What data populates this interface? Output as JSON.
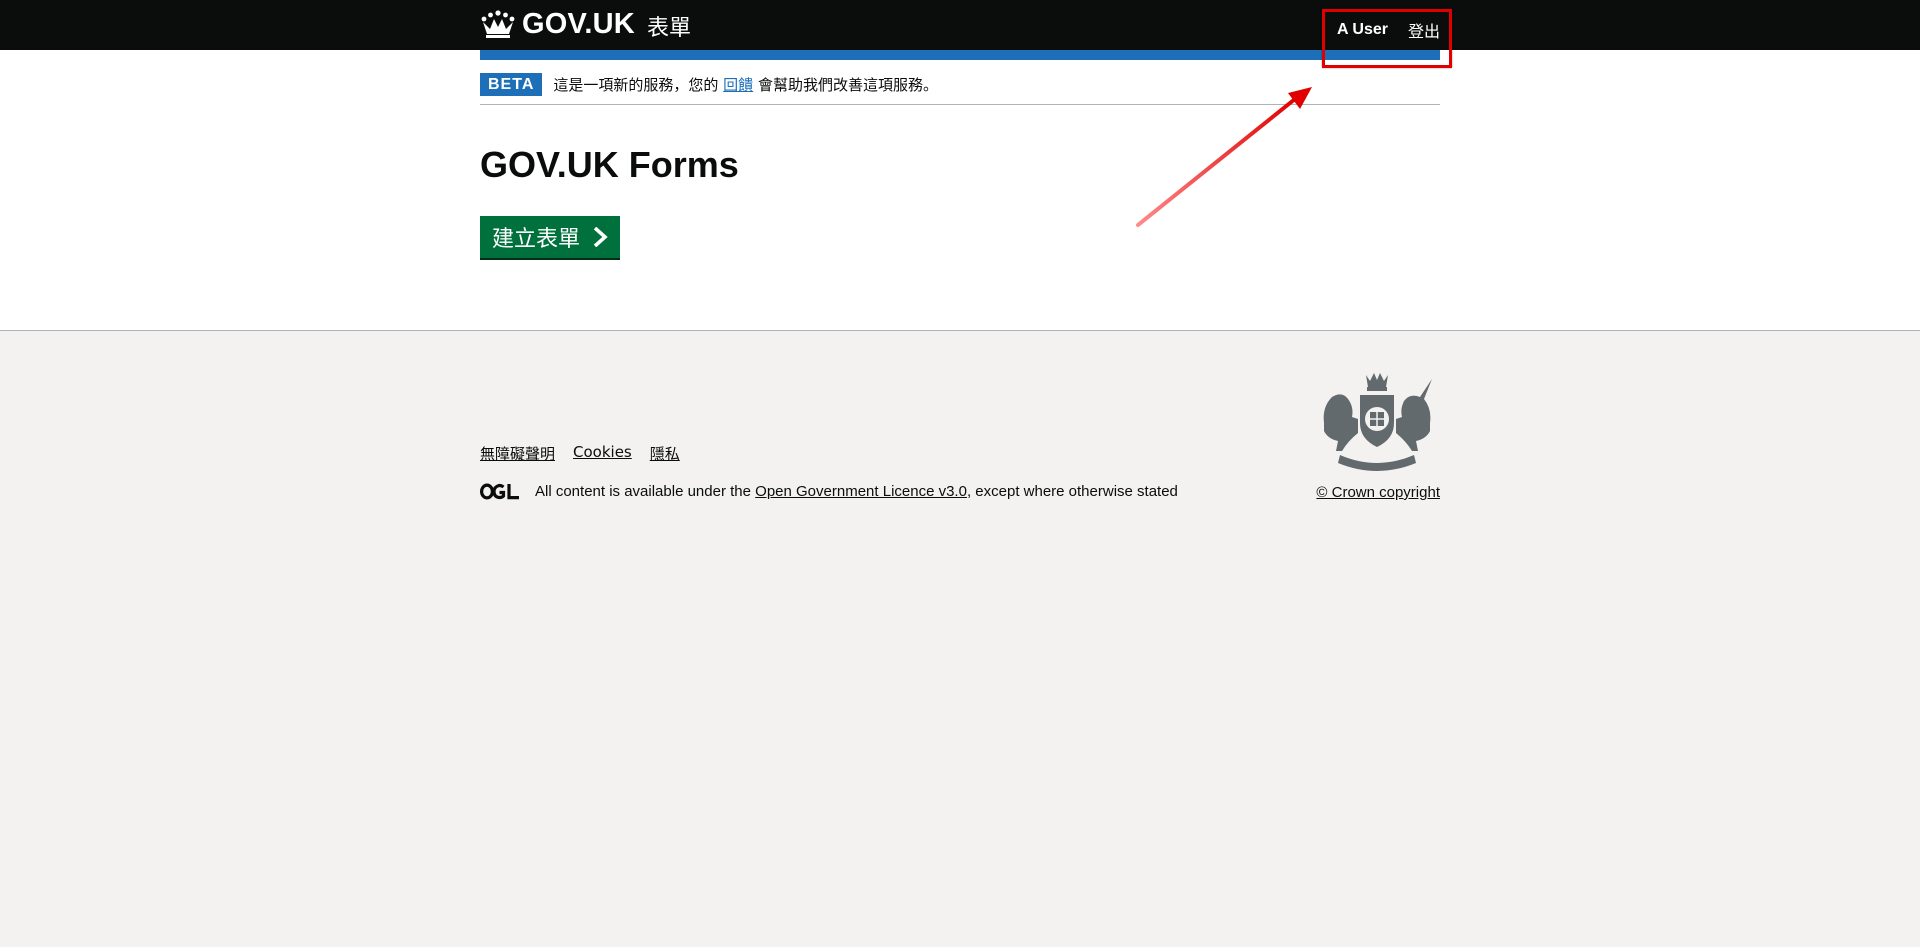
{
  "header": {
    "logo_text": "GOV.UK",
    "service_name": "表單",
    "crown_icon": "crown-icon",
    "user_name": "A User",
    "sign_out_label": "登出",
    "background_color": "#0b0c0c"
  },
  "phase_banner": {
    "tag": "BETA",
    "text_before": "這是一項新的服務，您的",
    "link_text": "回饋",
    "text_after": "會幫助我們改善這項服務。"
  },
  "main": {
    "title": "GOV.UK Forms",
    "create_button_label": "建立表單",
    "button_color": "#00703c"
  },
  "footer": {
    "links": [
      {
        "label": "無障礙聲明"
      },
      {
        "label": "Cookies"
      },
      {
        "label": "隱私"
      }
    ],
    "licence_text_before": "All content is available under the",
    "licence_link": "Open Government Licence v3.0",
    "licence_text_after": ", except where otherwise stated",
    "copyright": "© Crown copyright",
    "ogl_logo": "ogl-logo",
    "crest_icon": "royal-coat-of-arms-icon"
  },
  "colors": {
    "link_blue": "#1d70b8",
    "footer_bg": "#f3f2f1",
    "annotation_red": "#e00000"
  }
}
